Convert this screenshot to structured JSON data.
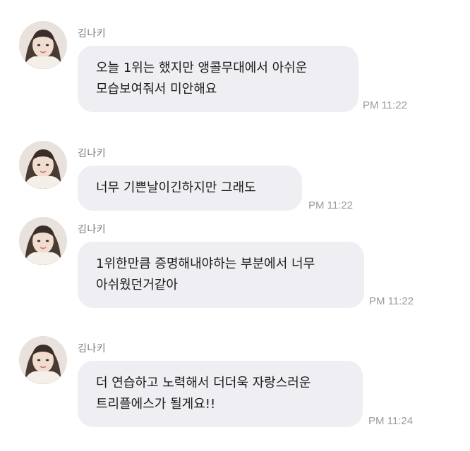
{
  "messages": [
    {
      "sender": "김나키",
      "lines": [
        "오늘 1위는 했지만 앵콜무대에서 아쉬운",
        "모습보여줘서 미안해요"
      ],
      "time": "PM 11:22"
    },
    {
      "sender": "김나키",
      "lines": [
        "너무 기쁜날이긴하지만 그래도"
      ],
      "time": "PM 11:22"
    },
    {
      "sender": "김나키",
      "lines": [
        "1위한만큼 증명해내야하는 부분에서 너무",
        "아쉬웠던거같아"
      ],
      "time": "PM 11:22"
    },
    {
      "sender": "김나키",
      "lines": [
        "더 연습하고 노력해서 더더욱 자랑스러운",
        "트리플에스가 될게요!!"
      ],
      "time": "PM 11:24"
    }
  ],
  "avatar_icon": "profile-photo",
  "colors": {
    "bubble": "#eeeef3",
    "text": "#1c1c1c",
    "meta": "#9b9b9b"
  }
}
